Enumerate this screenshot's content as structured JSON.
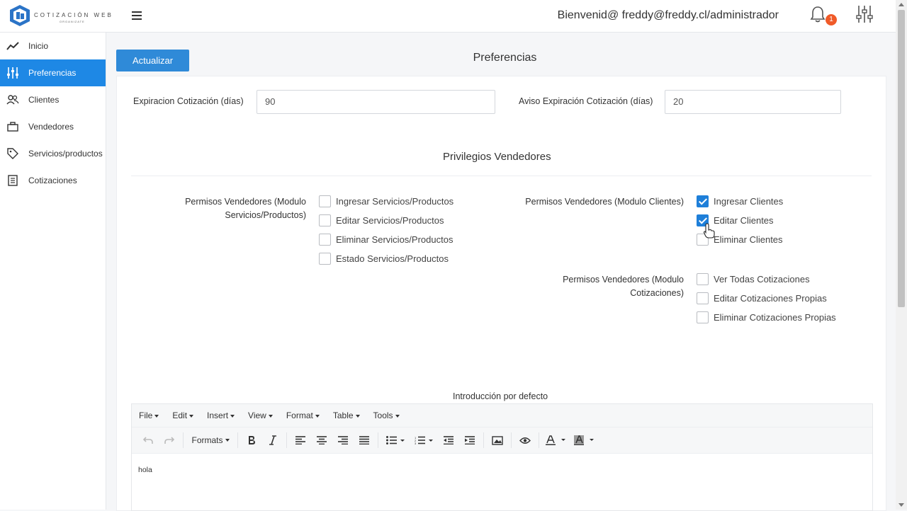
{
  "app": {
    "logo_text": "COTIZACIÓN WEB",
    "logo_sub": "ORGANIZATE",
    "welcome": "Bienvenid@ freddy@freddy.cl/administrador",
    "notification_count": "1"
  },
  "sidebar": {
    "items": [
      {
        "label": "Inicio",
        "icon": "chart-line-icon"
      },
      {
        "label": "Preferencias",
        "icon": "sliders-icon",
        "active": true
      },
      {
        "label": "Clientes",
        "icon": "users-icon"
      },
      {
        "label": "Vendedores",
        "icon": "briefcase-icon"
      },
      {
        "label": "Servicios/productos",
        "icon": "tag-icon"
      },
      {
        "label": "Cotizaciones",
        "icon": "document-icon"
      }
    ]
  },
  "main": {
    "update_button": "Actualizar",
    "title": "Preferencias",
    "expiration_label": "Expiracion Cotización (días)",
    "expiration_value": "90",
    "notice_label": "Aviso Expiración Cotización (días)",
    "notice_value": "20",
    "privileges_title": "Privilegios Vendedores",
    "services_group_label": "Permisos Vendedores (Modulo Servicios/Productos)",
    "services_checks": [
      {
        "label": "Ingresar Servicios/Productos",
        "checked": false
      },
      {
        "label": "Editar Servicios/Productos",
        "checked": false
      },
      {
        "label": "Eliminar Servicios/Productos",
        "checked": false
      },
      {
        "label": "Estado Servicios/Productos",
        "checked": false
      }
    ],
    "clients_group_label": "Permisos Vendedores (Modulo Clientes)",
    "clients_checks": [
      {
        "label": "Ingresar Clientes",
        "checked": true
      },
      {
        "label": "Editar Clientes",
        "checked": true
      },
      {
        "label": "Eliminar Clientes",
        "checked": false
      }
    ],
    "quotes_group_label": "Permisos Vendedores (Modulo Cotizaciones)",
    "quotes_checks": [
      {
        "label": "Ver Todas Cotizaciones",
        "checked": false
      },
      {
        "label": "Editar Cotizaciones Propias",
        "checked": false
      },
      {
        "label": "Eliminar Cotizaciones Propias",
        "checked": false
      }
    ],
    "editor_title": "Introducción por defecto",
    "editor_menu": [
      "File",
      "Edit",
      "Insert",
      "View",
      "Format",
      "Table",
      "Tools"
    ],
    "formats_label": "Formats",
    "editor_content": "hola"
  },
  "colors": {
    "accent": "#1e88e5",
    "badge": "#f05a28"
  }
}
